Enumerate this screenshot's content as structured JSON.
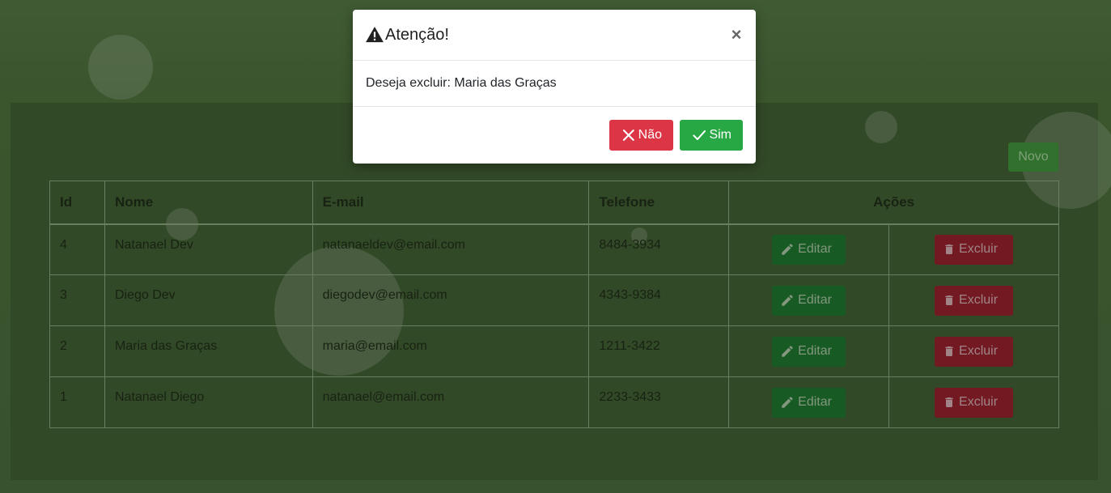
{
  "toolbar": {
    "new_label": "Novo"
  },
  "table": {
    "headers": {
      "id": "Id",
      "name": "Nome",
      "email": "E-mail",
      "phone": "Telefone",
      "actions": "Ações"
    },
    "rows": [
      {
        "id": "4",
        "name": "Natanael Dev",
        "email": "natanaeldev@email.com",
        "phone": "8484-3934"
      },
      {
        "id": "3",
        "name": "Diego Dev",
        "email": "diegodev@email.com",
        "phone": "4343-9384"
      },
      {
        "id": "2",
        "name": "Maria das Graças",
        "email": "maria@email.com",
        "phone": "1211-3422"
      },
      {
        "id": "1",
        "name": "Natanael Diego",
        "email": "natanael@email.com",
        "phone": "2233-3433"
      }
    ],
    "edit_label": "Editar",
    "delete_label": "Excluir"
  },
  "modal": {
    "title": "Atenção!",
    "close_glyph": "×",
    "message": "Deseja excluir: Maria das Graças",
    "no_label": "Não",
    "yes_label": "Sim"
  },
  "icons": {
    "warning": "warning-icon",
    "pencil": "pencil-icon",
    "trash": "trash-icon",
    "x": "x-icon",
    "check": "check-icon"
  },
  "colors": {
    "danger": "#dc3545",
    "success": "#28a745",
    "background": "#4a6a3a"
  }
}
